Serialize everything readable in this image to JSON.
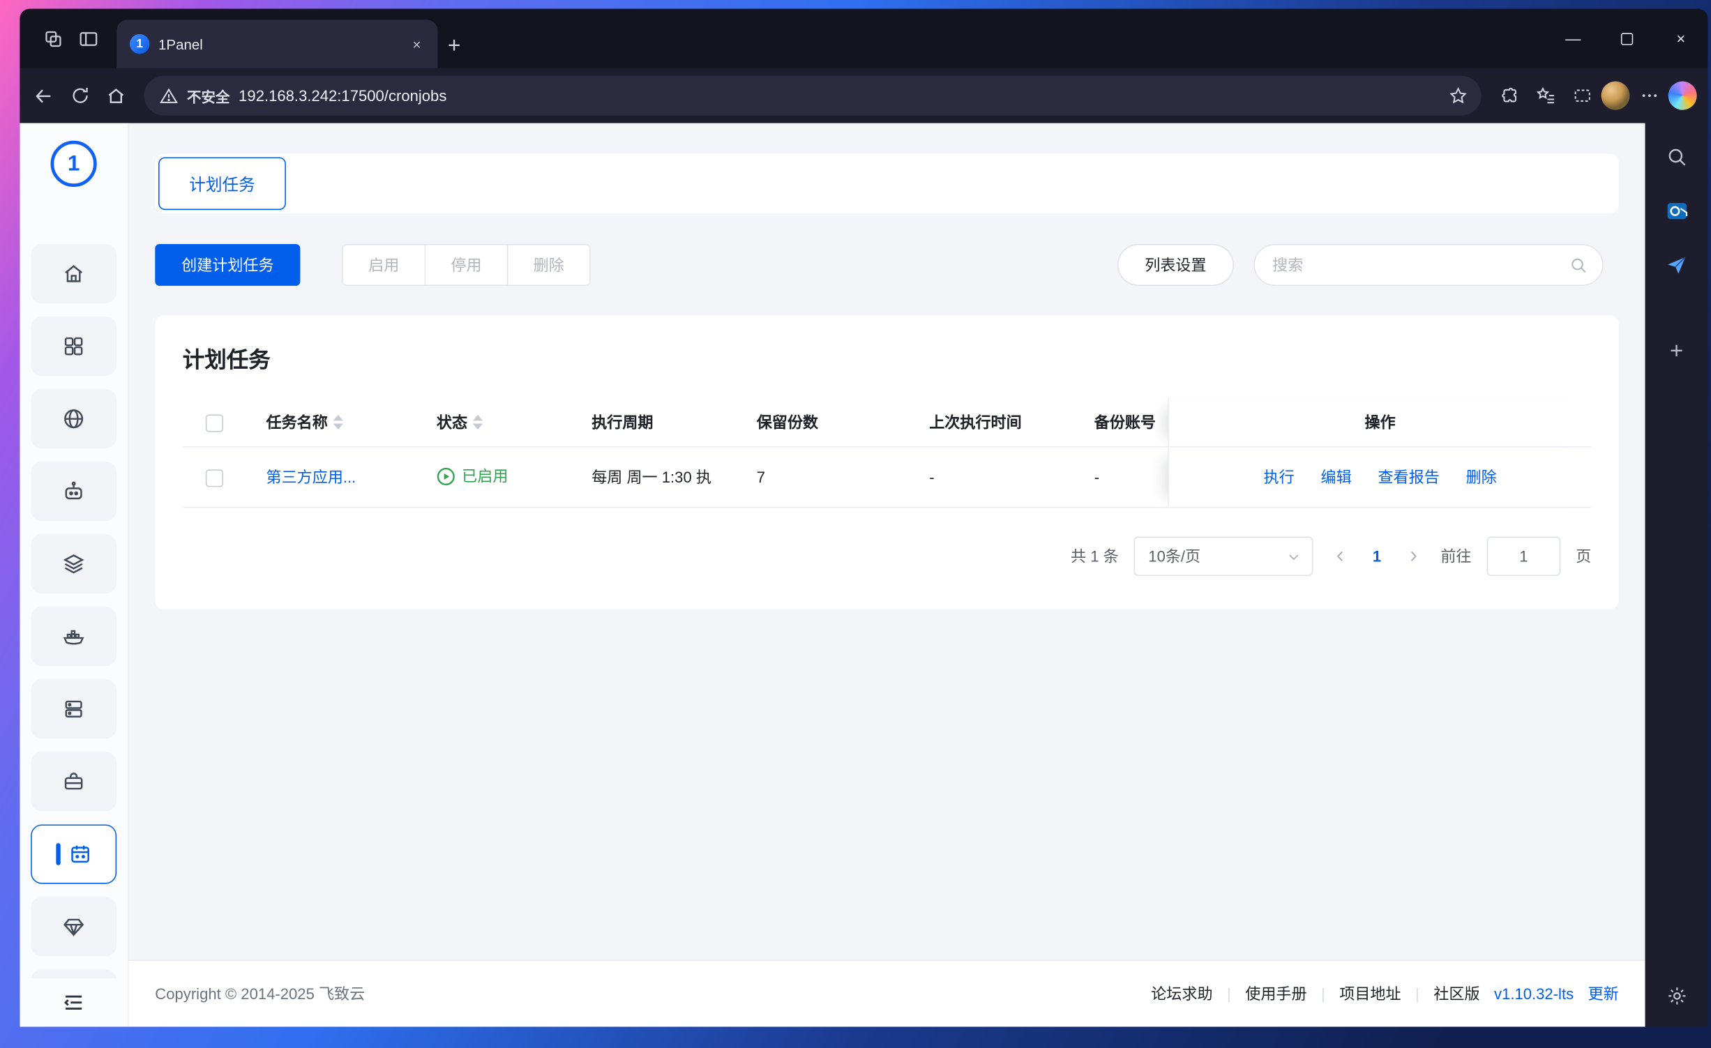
{
  "browser": {
    "tab": {
      "title": "1Panel",
      "favicon": "1"
    },
    "glyphs": {
      "minimize": "—",
      "close": "×",
      "plus": "+"
    },
    "address": {
      "security": "不安全",
      "url": "192.168.3.242:17500/cronjobs"
    }
  },
  "app": {
    "logo": "1",
    "sidebar_items": [
      "overview",
      "app-store",
      "website",
      "ai",
      "database",
      "container",
      "host",
      "toolbox",
      "cronjob",
      "license",
      "terminal"
    ],
    "active_item": "cronjob"
  },
  "page": {
    "tab_label": "计划任务",
    "toolbar": {
      "create": "创建计划任务",
      "enable": "启用",
      "disable": "停用",
      "remove": "删除",
      "list_settings": "列表设置",
      "search_placeholder": "搜索"
    },
    "card": {
      "title": "计划任务",
      "table": {
        "columns": [
          "任务名称",
          "状态",
          "执行周期",
          "保留份数",
          "上次执行时间",
          "备份账号",
          "操作"
        ],
        "row": {
          "name": "第三方应用...",
          "status": "已启用",
          "schedule": "每周 周一 1:30 执",
          "copies": "7",
          "last_run": "-",
          "backup_account": "-",
          "actions": [
            "执行",
            "编辑",
            "查看报告",
            "删除"
          ]
        }
      },
      "pagination": {
        "total": "共 1 条",
        "page_size": "10条/页",
        "page": "1",
        "goto": "前往",
        "goto_value": "1",
        "unit": "页"
      }
    },
    "footer": {
      "copyright": "Copyright © 2014-2025 飞致云",
      "links": [
        "论坛求助",
        "使用手册",
        "项目地址",
        "社区版"
      ],
      "separator": "|",
      "version": "v1.10.32-lts",
      "update": "更新"
    }
  },
  "colors": {
    "primary": "#005eeb",
    "success": "#2da44e",
    "chrome_dark": "#1d1d2e"
  }
}
